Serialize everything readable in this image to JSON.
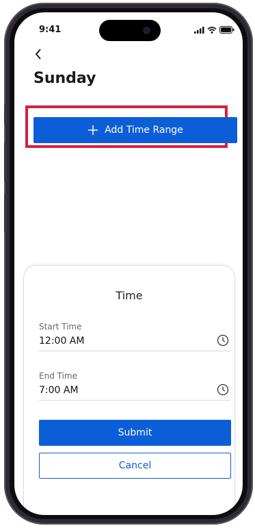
{
  "status_bar": {
    "time": "9:41"
  },
  "page": {
    "title": "Sunday"
  },
  "actions": {
    "add_time_range_label": "Add Time Range"
  },
  "time_sheet": {
    "title": "Time",
    "start_time": {
      "label": "Start Time",
      "value": "12:00 AM"
    },
    "end_time": {
      "label": "End Time",
      "value": "7:00 AM"
    },
    "submit_label": "Submit",
    "cancel_label": "Cancel"
  },
  "colors": {
    "primary": "#0b5ed7",
    "highlight": "#d81f3c"
  },
  "icons": [
    "back-chevron-icon",
    "plus-icon",
    "clock-icon",
    "signal-icon",
    "wifi-icon",
    "battery-icon"
  ]
}
